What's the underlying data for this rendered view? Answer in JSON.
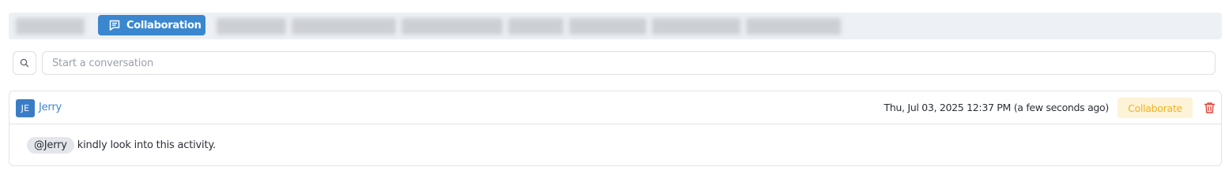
{
  "tabs": {
    "active_label": "Collaboration",
    "active_icon": "message-square-icon",
    "accent": "#3a87d0"
  },
  "search": {
    "icon": "search-icon",
    "placeholder": "Start a conversation",
    "value": ""
  },
  "comment": {
    "avatar_initials": "JE",
    "author": "Jerry",
    "timestamp": "Thu, Jul 03, 2025 12:37 PM (a few seconds ago)",
    "collaborate_label": "Collaborate",
    "delete_icon": "trash-icon",
    "mention": "@Jerry",
    "text": "kindly look into this activity."
  }
}
